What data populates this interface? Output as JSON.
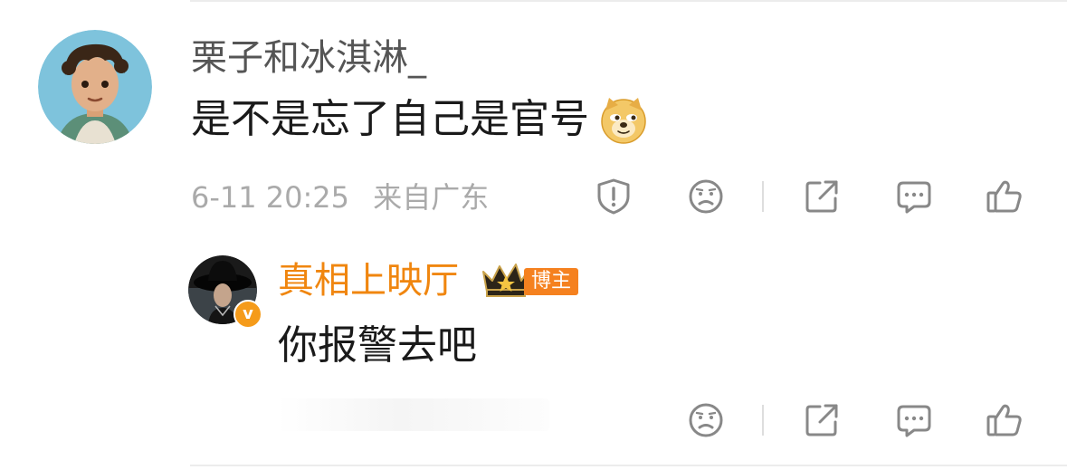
{
  "comment": {
    "username": "栗子和冰淇淋_",
    "text": "是不是忘了自己是官号",
    "emoji": "doge-emoji",
    "date": "6-11 20:25",
    "location": "来自广东",
    "actions": [
      "report-icon",
      "dislike-icon",
      "share-icon",
      "reply-icon",
      "like-icon"
    ]
  },
  "reply": {
    "username": "真相上映厅",
    "badge": "v-verified",
    "tag": "博主",
    "text": "你报警去吧",
    "actions": [
      "dislike-icon",
      "share-icon",
      "reply-icon",
      "like-icon"
    ]
  },
  "colors": {
    "username_gray": "#555555",
    "text_black": "#1a1a1a",
    "meta_gray": "#aaaaaa",
    "blogger_orange": "#f0860f",
    "tag_orange": "#f5811f",
    "icon_gray": "#888888"
  }
}
